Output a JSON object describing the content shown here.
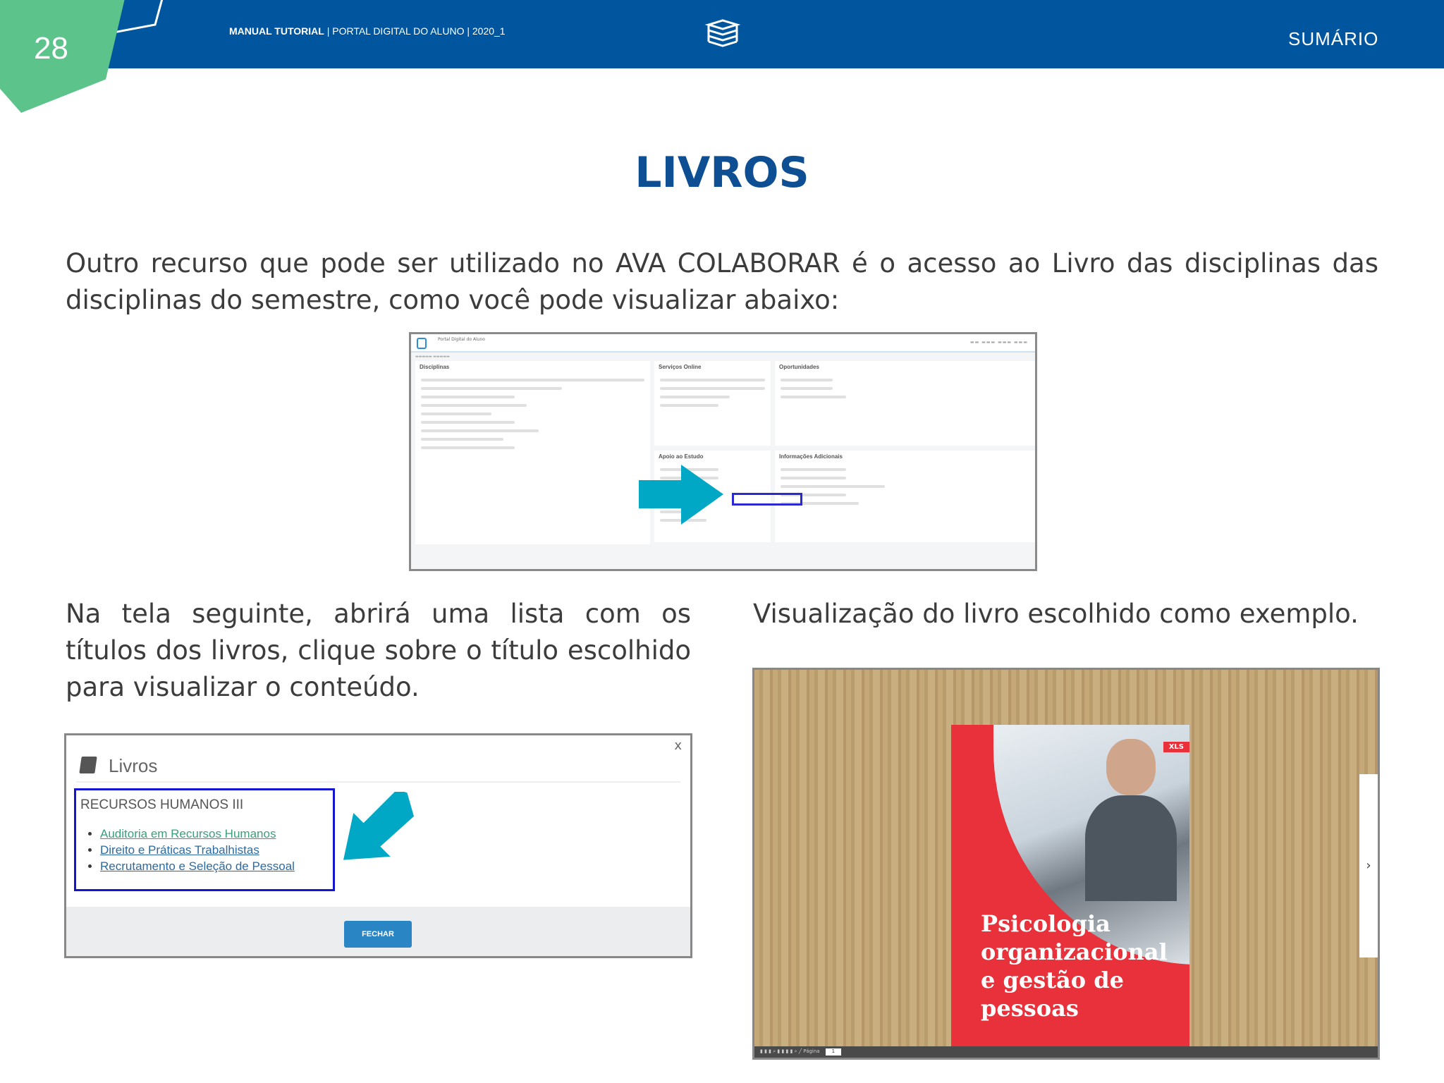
{
  "header": {
    "page_number": "28",
    "doc_title_bold": "MANUAL TUTORIAL",
    "doc_title_rest": " | PORTAL DIGITAL DO ALUNO | 2020_1",
    "summary_link": "SUMÁRIO",
    "brand_color": "#00569e",
    "accent_green": "#5cc38b"
  },
  "title": "LIVROS",
  "intro": "Outro recurso que pode ser utilizado no AVA COLABORAR é o acesso ao Livro das disciplinas das disciplinas do semestre, como você pode visualizar abaixo:",
  "portal_screenshot": {
    "brand": "Portal Digital do Aluno",
    "panels": [
      "Disciplinas",
      "Serviços Online",
      "Oportunidades",
      "Apoio ao Estudo",
      "Informações Adicionais"
    ]
  },
  "left_text": "Na tela seguinte, abrirá uma lista com os títulos dos livros, clique sobre o título escolhido para visualizar o conteúdo.",
  "right_text": "Visualização do livro escolhido como exemplo.",
  "dialog": {
    "title": "Livros",
    "close": "x",
    "course": "RECURSOS HUMANOS III",
    "books": [
      "Auditoria em Recursos Humanos",
      "Direito e Práticas Trabalhistas",
      "Recrutamento e Seleção de Pessoal"
    ],
    "close_button": "FECHAR"
  },
  "viewer": {
    "cover_title": "Psicologia organizacional e gestão de pessoas",
    "badge": "XLS",
    "next": "›",
    "page_label": "Página",
    "page_value": "1"
  }
}
